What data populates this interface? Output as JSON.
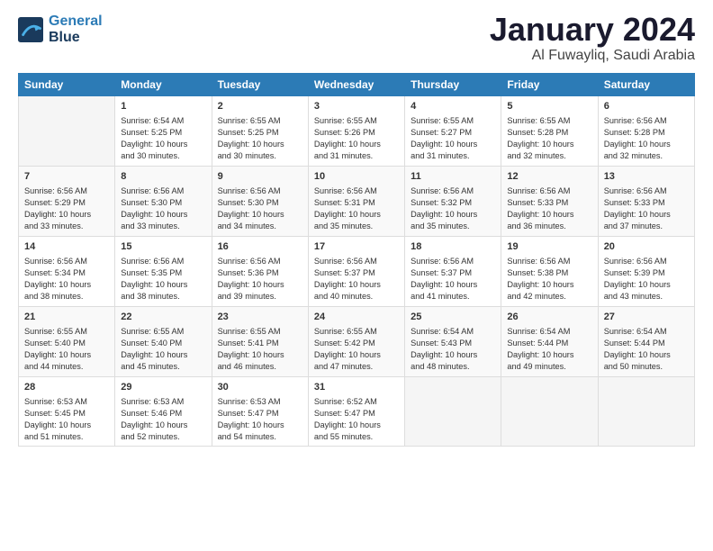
{
  "logo": {
    "line1": "General",
    "line2": "Blue"
  },
  "title": "January 2024",
  "subtitle": "Al Fuwayliq, Saudi Arabia",
  "header_days": [
    "Sunday",
    "Monday",
    "Tuesday",
    "Wednesday",
    "Thursday",
    "Friday",
    "Saturday"
  ],
  "weeks": [
    [
      {
        "day": "",
        "info": ""
      },
      {
        "day": "1",
        "info": "Sunrise: 6:54 AM\nSunset: 5:25 PM\nDaylight: 10 hours\nand 30 minutes."
      },
      {
        "day": "2",
        "info": "Sunrise: 6:55 AM\nSunset: 5:25 PM\nDaylight: 10 hours\nand 30 minutes."
      },
      {
        "day": "3",
        "info": "Sunrise: 6:55 AM\nSunset: 5:26 PM\nDaylight: 10 hours\nand 31 minutes."
      },
      {
        "day": "4",
        "info": "Sunrise: 6:55 AM\nSunset: 5:27 PM\nDaylight: 10 hours\nand 31 minutes."
      },
      {
        "day": "5",
        "info": "Sunrise: 6:55 AM\nSunset: 5:28 PM\nDaylight: 10 hours\nand 32 minutes."
      },
      {
        "day": "6",
        "info": "Sunrise: 6:56 AM\nSunset: 5:28 PM\nDaylight: 10 hours\nand 32 minutes."
      }
    ],
    [
      {
        "day": "7",
        "info": "Sunrise: 6:56 AM\nSunset: 5:29 PM\nDaylight: 10 hours\nand 33 minutes."
      },
      {
        "day": "8",
        "info": "Sunrise: 6:56 AM\nSunset: 5:30 PM\nDaylight: 10 hours\nand 33 minutes."
      },
      {
        "day": "9",
        "info": "Sunrise: 6:56 AM\nSunset: 5:30 PM\nDaylight: 10 hours\nand 34 minutes."
      },
      {
        "day": "10",
        "info": "Sunrise: 6:56 AM\nSunset: 5:31 PM\nDaylight: 10 hours\nand 35 minutes."
      },
      {
        "day": "11",
        "info": "Sunrise: 6:56 AM\nSunset: 5:32 PM\nDaylight: 10 hours\nand 35 minutes."
      },
      {
        "day": "12",
        "info": "Sunrise: 6:56 AM\nSunset: 5:33 PM\nDaylight: 10 hours\nand 36 minutes."
      },
      {
        "day": "13",
        "info": "Sunrise: 6:56 AM\nSunset: 5:33 PM\nDaylight: 10 hours\nand 37 minutes."
      }
    ],
    [
      {
        "day": "14",
        "info": "Sunrise: 6:56 AM\nSunset: 5:34 PM\nDaylight: 10 hours\nand 38 minutes."
      },
      {
        "day": "15",
        "info": "Sunrise: 6:56 AM\nSunset: 5:35 PM\nDaylight: 10 hours\nand 38 minutes."
      },
      {
        "day": "16",
        "info": "Sunrise: 6:56 AM\nSunset: 5:36 PM\nDaylight: 10 hours\nand 39 minutes."
      },
      {
        "day": "17",
        "info": "Sunrise: 6:56 AM\nSunset: 5:37 PM\nDaylight: 10 hours\nand 40 minutes."
      },
      {
        "day": "18",
        "info": "Sunrise: 6:56 AM\nSunset: 5:37 PM\nDaylight: 10 hours\nand 41 minutes."
      },
      {
        "day": "19",
        "info": "Sunrise: 6:56 AM\nSunset: 5:38 PM\nDaylight: 10 hours\nand 42 minutes."
      },
      {
        "day": "20",
        "info": "Sunrise: 6:56 AM\nSunset: 5:39 PM\nDaylight: 10 hours\nand 43 minutes."
      }
    ],
    [
      {
        "day": "21",
        "info": "Sunrise: 6:55 AM\nSunset: 5:40 PM\nDaylight: 10 hours\nand 44 minutes."
      },
      {
        "day": "22",
        "info": "Sunrise: 6:55 AM\nSunset: 5:40 PM\nDaylight: 10 hours\nand 45 minutes."
      },
      {
        "day": "23",
        "info": "Sunrise: 6:55 AM\nSunset: 5:41 PM\nDaylight: 10 hours\nand 46 minutes."
      },
      {
        "day": "24",
        "info": "Sunrise: 6:55 AM\nSunset: 5:42 PM\nDaylight: 10 hours\nand 47 minutes."
      },
      {
        "day": "25",
        "info": "Sunrise: 6:54 AM\nSunset: 5:43 PM\nDaylight: 10 hours\nand 48 minutes."
      },
      {
        "day": "26",
        "info": "Sunrise: 6:54 AM\nSunset: 5:44 PM\nDaylight: 10 hours\nand 49 minutes."
      },
      {
        "day": "27",
        "info": "Sunrise: 6:54 AM\nSunset: 5:44 PM\nDaylight: 10 hours\nand 50 minutes."
      }
    ],
    [
      {
        "day": "28",
        "info": "Sunrise: 6:53 AM\nSunset: 5:45 PM\nDaylight: 10 hours\nand 51 minutes."
      },
      {
        "day": "29",
        "info": "Sunrise: 6:53 AM\nSunset: 5:46 PM\nDaylight: 10 hours\nand 52 minutes."
      },
      {
        "day": "30",
        "info": "Sunrise: 6:53 AM\nSunset: 5:47 PM\nDaylight: 10 hours\nand 54 minutes."
      },
      {
        "day": "31",
        "info": "Sunrise: 6:52 AM\nSunset: 5:47 PM\nDaylight: 10 hours\nand 55 minutes."
      },
      {
        "day": "",
        "info": ""
      },
      {
        "day": "",
        "info": ""
      },
      {
        "day": "",
        "info": ""
      }
    ]
  ]
}
